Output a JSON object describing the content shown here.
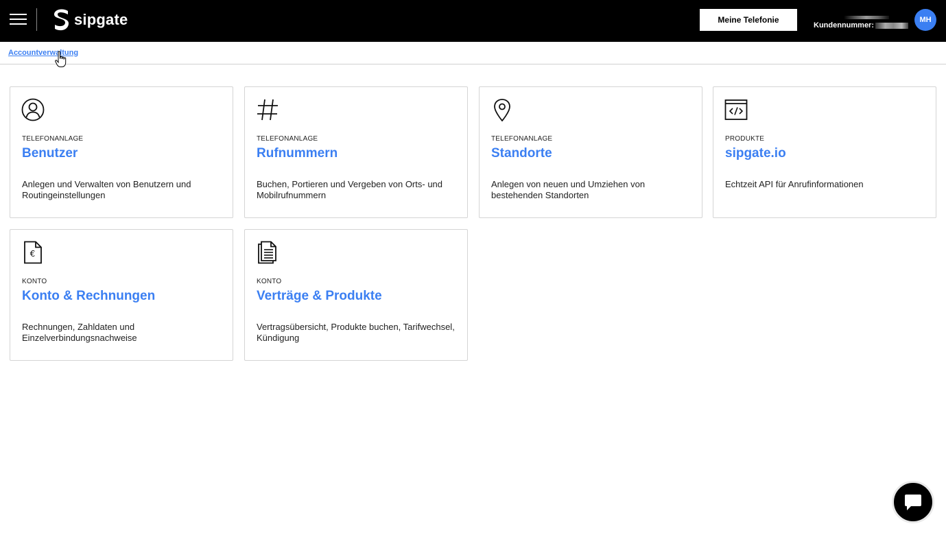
{
  "header": {
    "brand": "sipgate",
    "meine_telefonie_label": "Meine Telefonie",
    "kundennummer_label": "Kundennummer:",
    "avatar_initials": "MH"
  },
  "breadcrumb": {
    "label": "Accountverwaltung"
  },
  "cards": [
    {
      "category": "TELEFONANLAGE",
      "title": "Benutzer",
      "description": "Anlegen und Verwalten von Benutzern und Routingeinstellungen",
      "icon": "user-icon"
    },
    {
      "category": "TELEFONANLAGE",
      "title": "Rufnummern",
      "description": "Buchen, Portieren und Vergeben von Orts- und Mobilrufnummern",
      "icon": "hash-icon"
    },
    {
      "category": "TELEFONANLAGE",
      "title": "Standorte",
      "description": "Anlegen von neuen und Umziehen von bestehenden Standorten",
      "icon": "location-pin-icon"
    },
    {
      "category": "PRODUKTE",
      "title": "sipgate.io",
      "description": "Echtzeit API für Anrufinformationen",
      "icon": "code-window-icon"
    },
    {
      "category": "KONTO",
      "title": "Konto & Rechnungen",
      "description": "Rechnungen, Zahldaten und Einzelverbindungsnachweise",
      "icon": "euro-document-icon"
    },
    {
      "category": "KONTO",
      "title": "Verträge & Produkte",
      "description": "Vertragsübersicht, Produkte buchen, Tarifwechsel, Kündigung",
      "icon": "documents-icon"
    }
  ],
  "colors": {
    "accent": "#3b7ff2",
    "header_bg": "#000000",
    "card_border": "#d4d4d4"
  }
}
